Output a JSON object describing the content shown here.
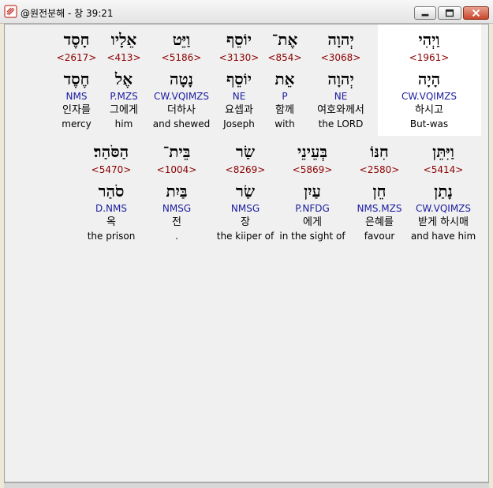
{
  "window": {
    "title": "@원전분해 - 창 39:21"
  },
  "rows": [
    {
      "words": [
        {
          "hebrew": "וַיְהִי",
          "strong": "<1961>",
          "lemma": "הָיָה",
          "parse": "CW.VQIMZS",
          "korean": "하시고",
          "english": "But-was"
        },
        {
          "hebrew": "יְהוָה",
          "strong": "<3068>",
          "lemma": "יְהוָה",
          "parse": "NE",
          "korean": "여호와께서",
          "english": "the LORD"
        },
        {
          "hebrew": "אֶת־",
          "strong": "<854>",
          "lemma": "אֵת",
          "parse": "P",
          "korean": "함께",
          "english": "with"
        },
        {
          "hebrew": "יוֹסֵף",
          "strong": "<3130>",
          "lemma": "יוֹסֵף",
          "parse": "NE",
          "korean": "요셉과",
          "english": "Joseph"
        },
        {
          "hebrew": "וַיֵּט",
          "strong": "<5186>",
          "lemma": "נָטָה",
          "parse": "CW.VQIMZS",
          "korean": "더하사",
          "english": "and shewed"
        },
        {
          "hebrew": "אֵלָיו",
          "strong": "<413>",
          "lemma": "אֶל",
          "parse": "P.MZS",
          "korean": "그에게",
          "english": "him"
        },
        {
          "hebrew": "חָסֶד",
          "strong": "<2617>",
          "lemma": "חֶסֶד",
          "parse": "NMS",
          "korean": "인자를",
          "english": "mercy"
        }
      ]
    },
    {
      "words": [
        {
          "hebrew": "וַיִּתֵּן",
          "strong": "<5414>",
          "lemma": "נָתַן",
          "parse": "CW.VQIMZS",
          "korean": "받게 하시매",
          "english": "and have him"
        },
        {
          "hebrew": "חִנּוֹ",
          "strong": "<2580>",
          "lemma": "חֵן",
          "parse": "NMS.MZS",
          "korean": "은혜를",
          "english": "favour"
        },
        {
          "hebrew": "בְּעֵינֵי",
          "strong": "<5869>",
          "lemma": "עַיִן",
          "parse": "P.NFDG",
          "korean": "에게",
          "english": "in the sight of"
        },
        {
          "hebrew": "שַׂר",
          "strong": "<8269>",
          "lemma": "שַׂר",
          "parse": "NMSG",
          "korean": "장",
          "english": "the kiiper of"
        },
        {
          "hebrew": "בֵּית־",
          "strong": "<1004>",
          "lemma": "בַּיִת",
          "parse": "NMSG",
          "korean": "전",
          "english": "."
        },
        {
          "hebrew": "הַסֹּהַר׃",
          "strong": "<5470>",
          "lemma": "סֹהַר",
          "parse": "D.NMS",
          "korean": "옥",
          "english": "the prison"
        }
      ]
    }
  ]
}
